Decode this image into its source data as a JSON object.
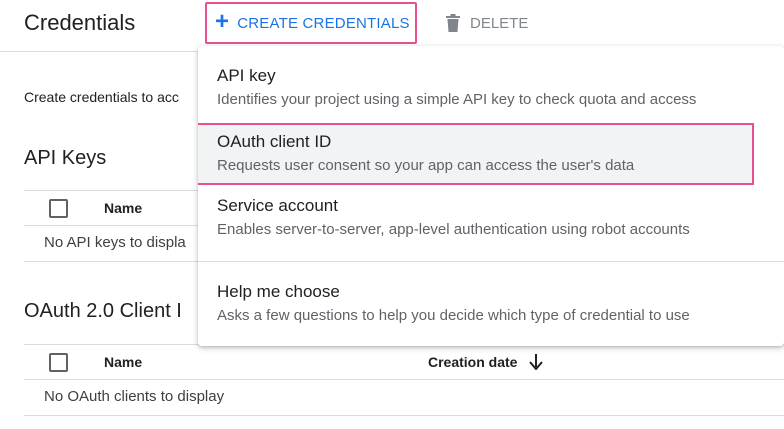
{
  "header": {
    "title": "Credentials",
    "create_label": "CREATE CREDENTIALS",
    "delete_label": "DELETE"
  },
  "intro_text": "Create credentials to acc",
  "api_keys": {
    "title": "API Keys",
    "col_name": "Name",
    "empty": "No API keys to displa"
  },
  "oauth": {
    "title": "OAuth 2.0 Client I",
    "col_name": "Name",
    "col_date": "Creation date",
    "empty": "No OAuth clients to display"
  },
  "menu": {
    "items": [
      {
        "title": "API key",
        "desc": "Identifies your project using a simple API key to check quota and access"
      },
      {
        "title": "OAuth client ID",
        "desc": "Requests user consent so your app can access the user's data"
      },
      {
        "title": "Service account",
        "desc": "Enables server-to-server, app-level authentication using robot accounts"
      },
      {
        "title": "Help me choose",
        "desc": "Asks a few questions to help you decide which type of credential to use"
      }
    ]
  },
  "colors": {
    "accent": "#1a73e8",
    "highlight_border": "#e8518f",
    "divider": "#dadce0"
  },
  "icons": {
    "create": "plus-icon",
    "delete": "trash-icon",
    "sort": "arrow-down-icon"
  }
}
